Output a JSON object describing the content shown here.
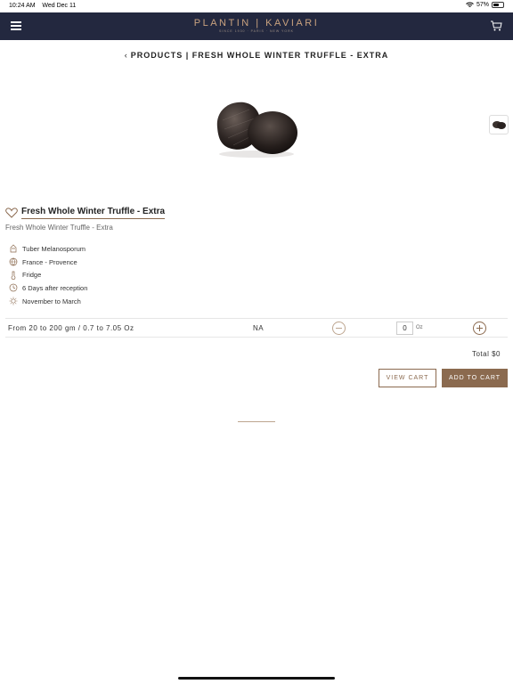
{
  "status_bar": {
    "time": "10:24 AM",
    "date": "Wed Dec 11",
    "battery": "57%",
    "battery_level": 0.57
  },
  "header": {
    "brand": "PLANTIN | KAVIARI",
    "tagline": "SINCE 1930 · PARIS · NEW YORK"
  },
  "breadcrumb": {
    "text": "PRODUCTS | FRESH WHOLE WINTER TRUFFLE - EXTRA"
  },
  "product": {
    "title": "Fresh Whole Winter Truffle - Extra",
    "subtitle": "Fresh Whole Winter Truffle - Extra",
    "attributes": [
      {
        "icon": "species-icon",
        "label": "Tuber Melanosporum"
      },
      {
        "icon": "globe-icon",
        "label": "France - Provence"
      },
      {
        "icon": "thermometer-icon",
        "label": "Fridge"
      },
      {
        "icon": "clock-icon",
        "label": "6 Days after reception"
      },
      {
        "icon": "sun-icon",
        "label": "November to March"
      }
    ]
  },
  "variant": {
    "description": "From 20 to 200 gm / 0.7 to 7.05 Oz",
    "price": "NA",
    "quantity": "0",
    "unit": "Oz"
  },
  "total": {
    "label": "Total $0"
  },
  "actions": {
    "view_cart": "VIEW CART",
    "add_to_cart": "ADD TO CART"
  },
  "colors": {
    "nav_bg": "#23283f",
    "accent": "#8b6a4f",
    "brand_gold": "#c9a27f"
  }
}
